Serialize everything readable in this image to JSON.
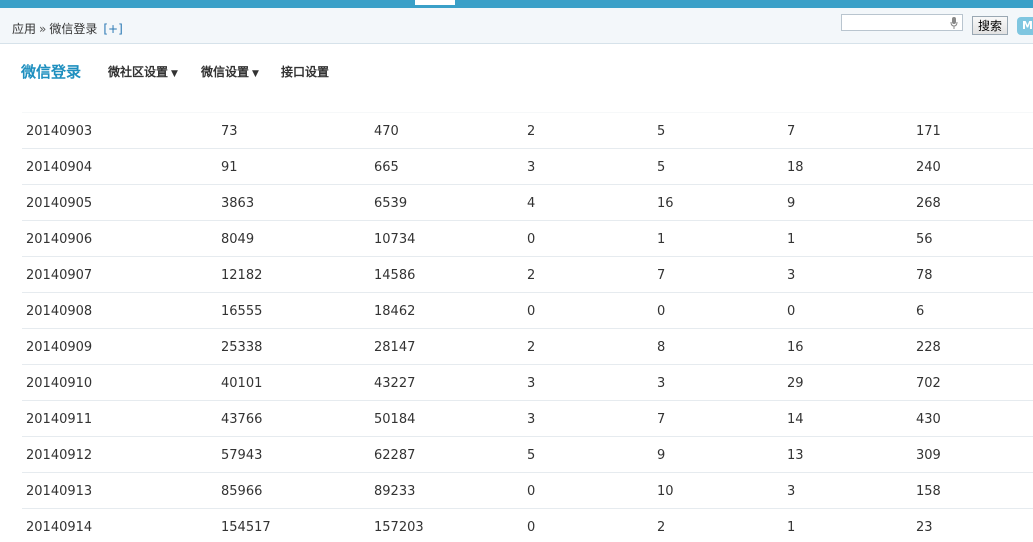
{
  "breadcrumb": {
    "root": "应用",
    "separator": "»",
    "current": "微信登录",
    "add": "[+]"
  },
  "search": {
    "value": "",
    "placeholder": "",
    "button_label": "搜索"
  },
  "corner_badge": "M",
  "nav": {
    "app_title": "微信登录",
    "menu": [
      {
        "label": "微社区设置",
        "has_dropdown": true
      },
      {
        "label": "微信设置",
        "has_dropdown": true
      },
      {
        "label": "接口设置",
        "has_dropdown": false
      }
    ]
  },
  "colors": {
    "accent": "#1e8fbf",
    "top_strip": "#3aa0c8",
    "header_bg": "#f3f7fa",
    "row_divider": "#e6ebef"
  },
  "table": {
    "rows": [
      [
        "20140903",
        "73",
        "470",
        "2",
        "5",
        "7",
        "171"
      ],
      [
        "20140904",
        "91",
        "665",
        "3",
        "5",
        "18",
        "240"
      ],
      [
        "20140905",
        "3863",
        "6539",
        "4",
        "16",
        "9",
        "268"
      ],
      [
        "20140906",
        "8049",
        "10734",
        "0",
        "1",
        "1",
        "56"
      ],
      [
        "20140907",
        "12182",
        "14586",
        "2",
        "7",
        "3",
        "78"
      ],
      [
        "20140908",
        "16555",
        "18462",
        "0",
        "0",
        "0",
        "6"
      ],
      [
        "20140909",
        "25338",
        "28147",
        "2",
        "8",
        "16",
        "228"
      ],
      [
        "20140910",
        "40101",
        "43227",
        "3",
        "3",
        "29",
        "702"
      ],
      [
        "20140911",
        "43766",
        "50184",
        "3",
        "7",
        "14",
        "430"
      ],
      [
        "20140912",
        "57943",
        "62287",
        "5",
        "9",
        "13",
        "309"
      ],
      [
        "20140913",
        "85966",
        "89233",
        "0",
        "10",
        "3",
        "158"
      ],
      [
        "20140914",
        "154517",
        "157203",
        "0",
        "2",
        "1",
        "23"
      ]
    ]
  }
}
